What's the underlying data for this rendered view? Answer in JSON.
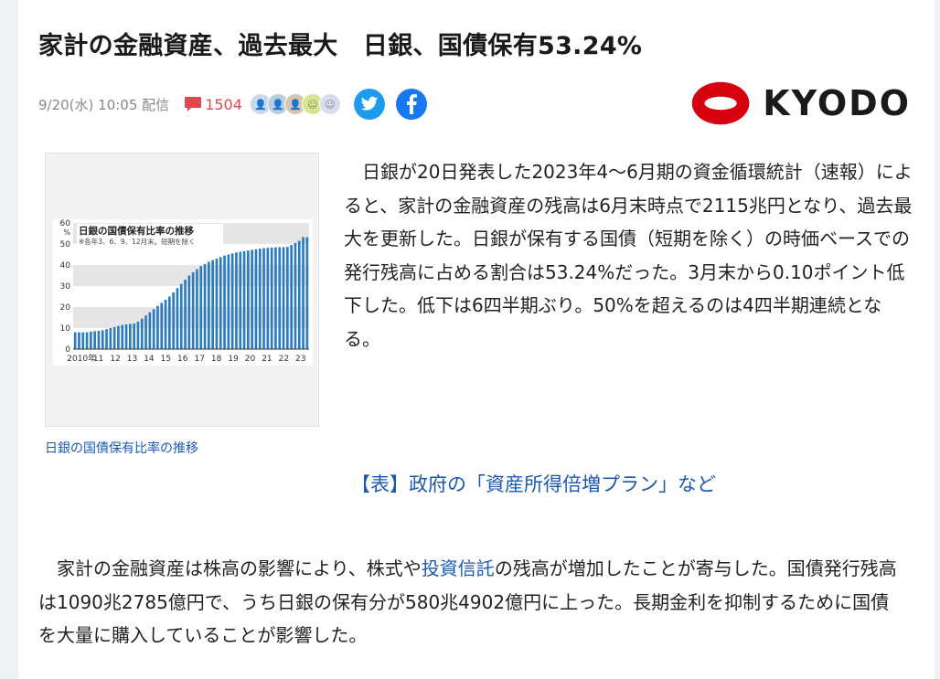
{
  "article": {
    "title": "家計の金融資産、過去最大　日銀、国債保有53.24%",
    "date": "9/20(水) 10:05",
    "distribution": "配信",
    "comment_count": "1504"
  },
  "publisher": {
    "name": "KYODO",
    "mark_color": "#d7000f"
  },
  "figure": {
    "caption": "日銀の国債保有比率の推移"
  },
  "chart_data": {
    "type": "bar",
    "title": "日銀の国債保有比率の推移",
    "subtitle": "※各年3、6、9、12月末。短期を除く",
    "ylabel": "%",
    "ylim": [
      0,
      60
    ],
    "yticks": [
      "0",
      "10",
      "20",
      "30",
      "40",
      "50",
      "60"
    ],
    "xticks": [
      "2010年",
      "11",
      "12",
      "13",
      "14",
      "15",
      "16",
      "17",
      "18",
      "19",
      "20",
      "21",
      "22",
      "23"
    ],
    "bar_color": "#2b7bbf",
    "values": [
      8,
      8,
      8,
      8,
      8.3,
      8.5,
      8.7,
      9,
      9.5,
      10,
      10.5,
      11,
      11.5,
      11.8,
      12,
      12.2,
      13,
      14.5,
      16,
      17.5,
      19,
      20.5,
      22,
      23.5,
      25,
      27,
      29,
      31,
      33,
      35,
      36.5,
      38,
      39.5,
      40.5,
      41.5,
      42.3,
      43,
      43.8,
      44.5,
      45,
      45.5,
      46,
      46.3,
      46.6,
      46.9,
      47.2,
      47.5,
      47.8,
      48,
      48.2,
      48.3,
      48.4,
      48.5,
      48.5,
      48.6,
      49.5,
      50.5,
      51.5,
      53.3,
      53.24
    ]
  },
  "body": {
    "p1": "日銀が20日発表した2023年4～6月期の資金循環統計（速報）によると、家計の金融資産の残高は6月末時点で2115兆円となり、過去最大を更新した。日銀が保有する国債（短期を除く）の時価ベースでの発行残高に占める割合は53.24%だった。3月末から0.10ポイント低下した。低下は6四半期ぶり。50%を超えるのは4四半期連続となる。",
    "related_link": "【表】政府の「資産所得倍増プラン」など",
    "p2_a": "家計の金融資産は株高の影響により、株式や",
    "p2_link": "投資信託",
    "p2_b": "の残高が増加したことが寄与した。国債発行残高は1090兆2785億円で、うち日銀の保有分が580兆4902億円に上った。長期金利を抑制するために国債を大量に購入していることが影響した。"
  }
}
